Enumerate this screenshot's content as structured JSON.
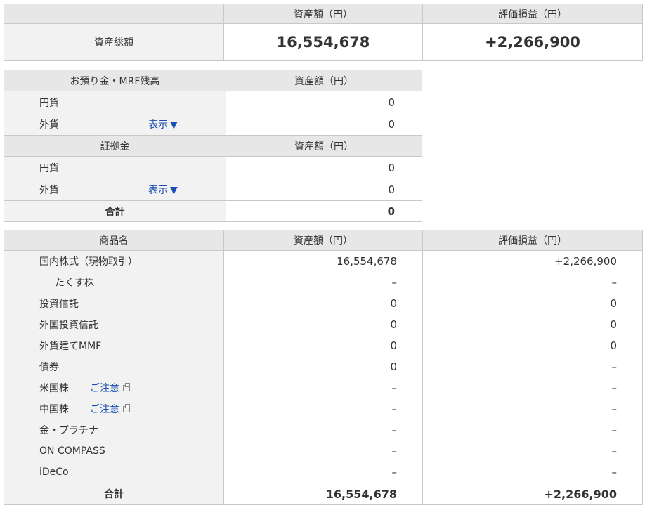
{
  "summary": {
    "col_asset": "資産額（円）",
    "col_pl": "評価損益（円）",
    "row_label": "資産総額",
    "total_asset": "16,554,678",
    "total_pl": "+2,266,900"
  },
  "deposits": {
    "header_label": "お預り金・MRF残高",
    "header_asset": "資産額（円）",
    "rows": [
      {
        "label": "円貨",
        "value": "0"
      },
      {
        "label": "外貨",
        "link": "表示",
        "value": "0"
      }
    ],
    "margin_header_label": "証拠金",
    "margin_header_asset": "資産額（円）",
    "margin_rows": [
      {
        "label": "円貨",
        "value": "0"
      },
      {
        "label": "外貨",
        "link": "表示",
        "value": "0"
      }
    ],
    "total_label": "合計",
    "total_value": "0",
    "arrow": "▼"
  },
  "products": {
    "col_name": "商品名",
    "col_asset": "資産額（円）",
    "col_pl": "評価損益（円）",
    "rows": [
      {
        "name": "国内株式（現物取引）",
        "asset": "16,554,678",
        "pl": "+2,266,900"
      },
      {
        "name": "たくす株",
        "asset": "–",
        "pl": "–"
      },
      {
        "name": "投資信託",
        "asset": "0",
        "pl": "0"
      },
      {
        "name": "外国投資信託",
        "asset": "0",
        "pl": "0"
      },
      {
        "name": "外貨建てMMF",
        "asset": "0",
        "pl": "0"
      },
      {
        "name": "債券",
        "asset": "0",
        "pl": "–"
      },
      {
        "name": "米国株",
        "notice": "ご注意",
        "asset": "–",
        "pl": "–"
      },
      {
        "name": "中国株",
        "notice": "ご注意",
        "asset": "–",
        "pl": "–"
      },
      {
        "name": "金・プラチナ",
        "asset": "–",
        "pl": "–"
      },
      {
        "name": "ON COMPASS",
        "asset": "–",
        "pl": "–"
      },
      {
        "name": "iDeCo",
        "asset": "–",
        "pl": "–"
      }
    ],
    "total_label": "合計",
    "total_asset": "16,554,678",
    "total_pl": "+2,266,900"
  },
  "icons": {
    "external": "external-window-icon",
    "dropdown": "triangle-down-icon"
  },
  "colors": {
    "header_bg": "#e7e7e7",
    "label_bg": "#f2f2f2",
    "link": "#1a4fb3",
    "border": "#c8c8c8"
  }
}
